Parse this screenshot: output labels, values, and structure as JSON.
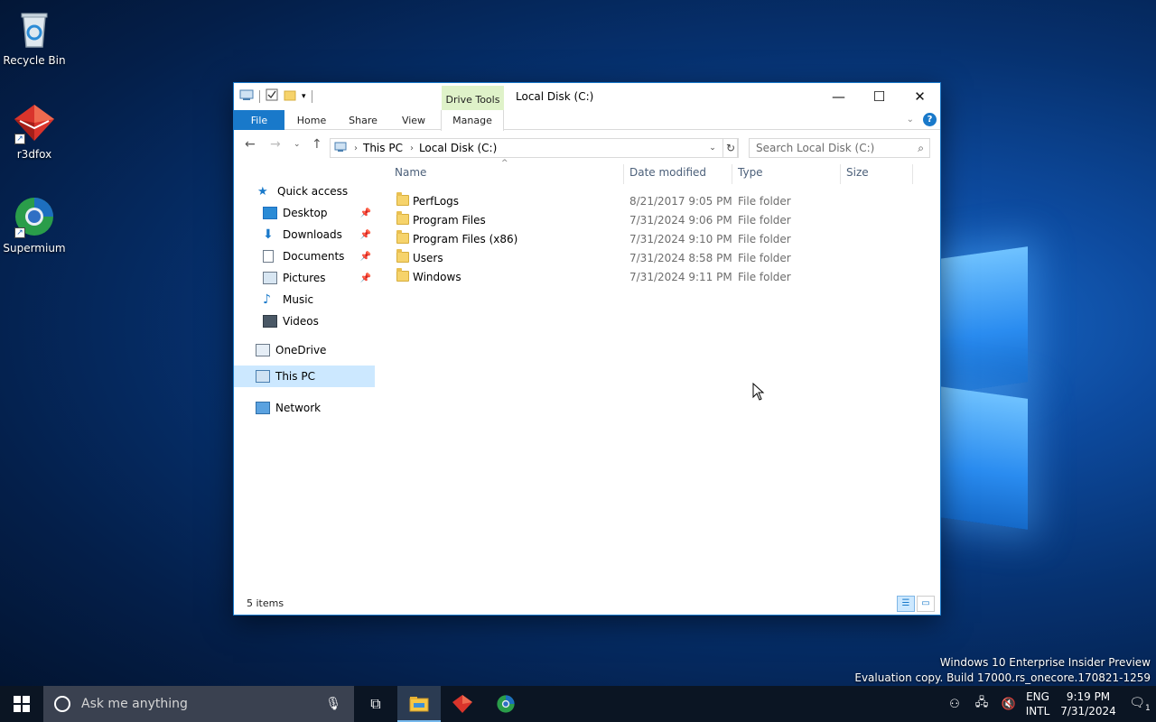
{
  "desktop": {
    "icons": [
      {
        "label": "Recycle Bin"
      },
      {
        "label": "r3dfox"
      },
      {
        "label": "Supermium"
      }
    ],
    "watermark": {
      "line1": "Windows 10 Enterprise Insider Preview",
      "line2": "Evaluation copy. Build 17000.rs_onecore.170821-1259"
    }
  },
  "window": {
    "title": "Local Disk (C:)",
    "context_tab_group": "Drive Tools",
    "ribbon_tabs": [
      "File",
      "Home",
      "Share",
      "View",
      "Manage"
    ],
    "address": {
      "crumbs": [
        "This PC",
        "Local Disk (C:)"
      ]
    },
    "search_placeholder": "Search Local Disk (C:)",
    "nav_pane": {
      "items": [
        {
          "label": "Quick access",
          "icon": "star-icon"
        },
        {
          "label": "Desktop",
          "icon": "desktop-icon",
          "pinned": true
        },
        {
          "label": "Downloads",
          "icon": "download-icon",
          "pinned": true
        },
        {
          "label": "Documents",
          "icon": "documents-icon",
          "pinned": true
        },
        {
          "label": "Pictures",
          "icon": "pictures-icon",
          "pinned": true
        },
        {
          "label": "Music",
          "icon": "music-icon"
        },
        {
          "label": "Videos",
          "icon": "videos-icon"
        },
        {
          "label": "OneDrive",
          "icon": "onedrive-icon"
        },
        {
          "label": "This PC",
          "icon": "this-pc-icon",
          "selected": true
        },
        {
          "label": "Network",
          "icon": "network-icon"
        }
      ]
    },
    "columns": [
      "Name",
      "Date modified",
      "Type",
      "Size"
    ],
    "files": [
      {
        "name": "PerfLogs",
        "date": "8/21/2017 9:05 PM",
        "type": "File folder"
      },
      {
        "name": "Program Files",
        "date": "7/31/2024 9:06 PM",
        "type": "File folder"
      },
      {
        "name": "Program Files (x86)",
        "date": "7/31/2024 9:10 PM",
        "type": "File folder"
      },
      {
        "name": "Users",
        "date": "7/31/2024 8:58 PM",
        "type": "File folder"
      },
      {
        "name": "Windows",
        "date": "7/31/2024 9:11 PM",
        "type": "File folder"
      }
    ],
    "status": "5 items"
  },
  "taskbar": {
    "search_placeholder": "Ask me anything",
    "lang_line1": "ENG",
    "lang_line2": "INTL",
    "time": "9:19 PM",
    "date": "7/31/2024",
    "notification_count": "1"
  },
  "colors": {
    "accent": "#1979ca",
    "context_tab": "#dff2c9",
    "selection": "#cce8ff"
  }
}
